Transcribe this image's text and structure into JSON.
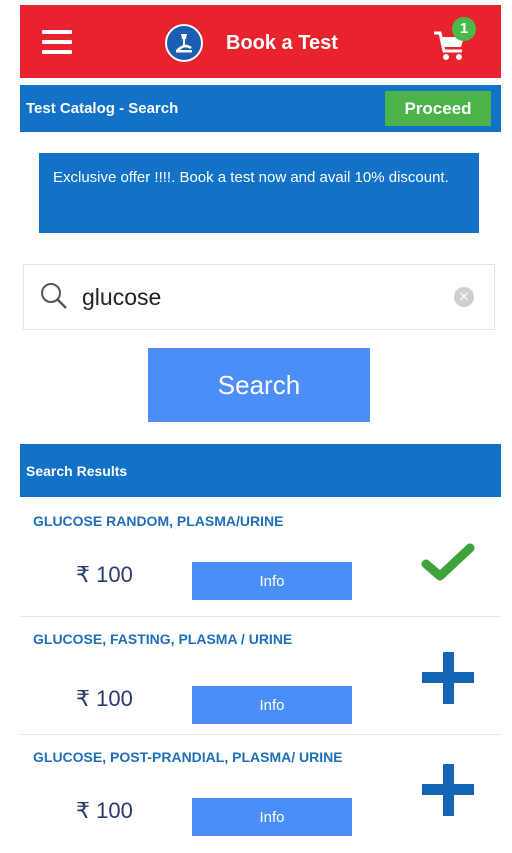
{
  "header": {
    "title": "Book a Test",
    "cart_count": "1",
    "icons": {
      "menu": "hamburger-menu-icon",
      "logo": "microscope-logo-icon",
      "cart": "shopping-cart-icon"
    },
    "colors": {
      "bar": "#e8232e",
      "badge": "#49b947"
    }
  },
  "subheader": {
    "title": "Test Catalog - Search",
    "proceed_label": "Proceed"
  },
  "offer": {
    "text": "Exclusive offer !!!!. Book a test now and avail 10% discount."
  },
  "search": {
    "value": "glucose",
    "button_label": "Search",
    "icons": {
      "search": "search-icon",
      "clear": "clear-icon"
    }
  },
  "results": {
    "title": "Search Results",
    "items": [
      {
        "name": "GLUCOSE RANDOM, PLASMA/URINE",
        "price": "₹ 100",
        "info_label": "Info",
        "status": "added",
        "status_icon": "check-icon"
      },
      {
        "name": "GLUCOSE, FASTING, PLASMA / URINE",
        "price": "₹ 100",
        "info_label": "Info",
        "status": "add",
        "status_icon": "plus-icon"
      },
      {
        "name": "GLUCOSE, POST-PRANDIAL, PLASMA/ URINE",
        "price": "₹ 100",
        "info_label": "Info",
        "status": "add",
        "status_icon": "plus-icon"
      }
    ]
  },
  "colors": {
    "primary_blue": "#1172c8",
    "button_blue": "#4c8ef7",
    "green": "#4bb34a"
  }
}
